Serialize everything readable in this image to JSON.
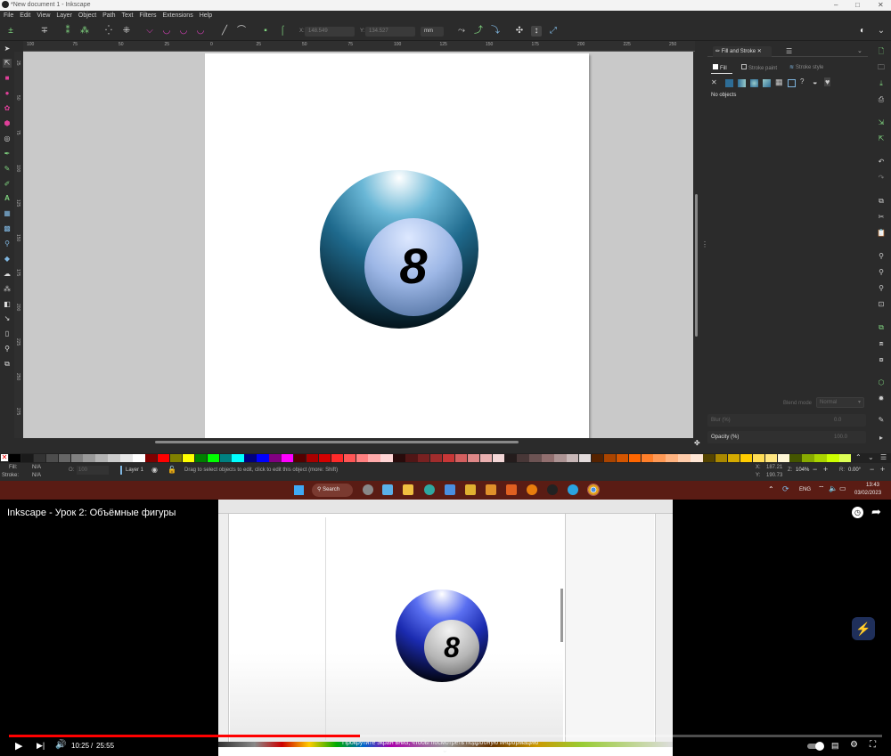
{
  "window": {
    "title": "*New document 1 - Inkscape",
    "controls": [
      "–",
      "□",
      "✕"
    ]
  },
  "menu": [
    "File",
    "Edit",
    "View",
    "Layer",
    "Object",
    "Path",
    "Text",
    "Filters",
    "Extensions",
    "Help"
  ],
  "toolbar": {
    "x_label": "X:",
    "x_value": "148.549",
    "y_label": "Y:",
    "y_value": "134.527",
    "unit": "mm"
  },
  "ruler_top_ticks": [
    "100",
    "75",
    "50",
    "25",
    "0",
    "25",
    "50",
    "75",
    "100",
    "125",
    "150",
    "175",
    "200",
    "225",
    "250"
  ],
  "ruler_left_ticks": [
    "25",
    "50",
    "75",
    "100",
    "125",
    "150",
    "175",
    "200",
    "225",
    "250",
    "275"
  ],
  "canvas": {
    "ball_number": "8"
  },
  "panel": {
    "tab_fill_stroke": "Fill and Stroke",
    "tab_close": "✕",
    "subtab_fill": "Fill",
    "subtab_stroke_paint": "Stroke paint",
    "subtab_stroke_style": "Stroke style",
    "no_objects": "No objects",
    "blend_label": "Blend mode",
    "blend_value": "Normal",
    "blur_label": "Blur (%)",
    "blur_value": "0.0",
    "opacity_label": "Opacity (%)",
    "opacity_value": "100.0"
  },
  "status": {
    "fill_label": "Fill:",
    "fill_value": "N/A",
    "stroke_label": "Stroke:",
    "stroke_value": "N/A",
    "o_label": "O:",
    "o_value": "100",
    "layer": "Layer 1",
    "message": "Drag to select objects to edit, click to edit this object (more: Shift)",
    "x_label": "X:",
    "x_value": "187.21",
    "y_label": "Y:",
    "y_value": "190.73",
    "z_label": "Z:",
    "zoom": "104%",
    "r_label": "R:",
    "rotation": "0.00°"
  },
  "taskbar": {
    "search": "Search",
    "lang": "ENG",
    "time": "13:43",
    "date": "03/02/2023"
  },
  "youtube": {
    "title": "Inkscape - Урок 2: Объёмные фигуры",
    "time_current": "10:25",
    "time_sep": "/",
    "time_total": "25:55",
    "progress": 0.402,
    "scroll_hint": "Прокрутите экран вниз, чтобы посмотреть подробную информацию",
    "ball_number": "8"
  },
  "colors": {
    "youtube_red": "#ff0000",
    "ball_teal": "#2a7fa6",
    "ball_blue_video": "#2b3fd6",
    "taskbar": "#5a1c14"
  },
  "palette_colors": [
    "#000000",
    "#1a1a1a",
    "#333333",
    "#4d4d4d",
    "#666666",
    "#808080",
    "#999999",
    "#b3b3b3",
    "#cccccc",
    "#e6e6e6",
    "#ffffff",
    "#800000",
    "#ff0000",
    "#808000",
    "#ffff00",
    "#008000",
    "#00ff00",
    "#008080",
    "#00ffff",
    "#000080",
    "#0000ff",
    "#800080",
    "#ff00ff",
    "#550000",
    "#aa0000",
    "#d40000",
    "#ff2a2a",
    "#ff5555",
    "#ff8080",
    "#ffaaaa",
    "#ffd5d5",
    "#280b0b",
    "#501616",
    "#782121",
    "#a02c2c",
    "#c83737",
    "#d35f5f",
    "#de8787",
    "#e9afaf",
    "#f4d7d7",
    "#241c1c",
    "#483737",
    "#6c5353",
    "#916f6f",
    "#ac9393",
    "#c8b7b7",
    "#e3dbdb",
    "#552200",
    "#aa4400",
    "#d45500",
    "#ff6600",
    "#ff7f2a",
    "#ff9955",
    "#ffb380",
    "#ffccaa",
    "#ffe6d5",
    "#554400",
    "#aa8800",
    "#d4aa00",
    "#ffcc00",
    "#ffdd55",
    "#ffe680",
    "#fff6d5",
    "#445500",
    "#88aa00",
    "#aad400",
    "#ccff00",
    "#ddff55"
  ]
}
